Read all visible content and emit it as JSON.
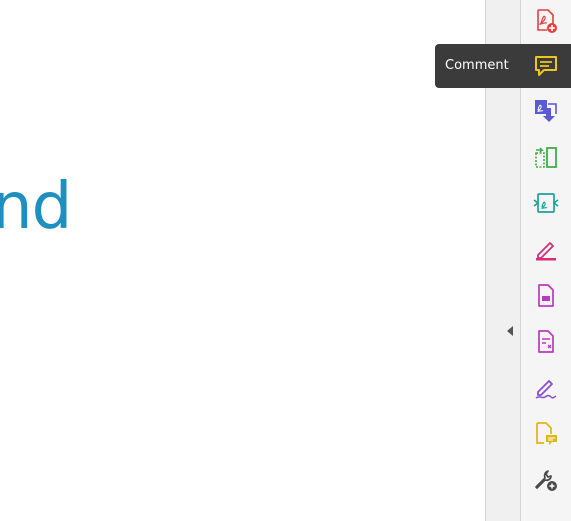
{
  "document": {
    "visible_text": "nd",
    "text_color": "#1f8fbf"
  },
  "tooltip": {
    "label": "Comment"
  },
  "toolbar": {
    "tools": [
      {
        "name": "create-pdf",
        "icon": "create-pdf-icon",
        "color": "#e0403f"
      },
      {
        "name": "comment",
        "icon": "comment-icon",
        "color": "#f0c419",
        "active": true
      },
      {
        "name": "export-pdf",
        "icon": "export-pdf-icon",
        "color": "#5a5ad6"
      },
      {
        "name": "organize-pages",
        "icon": "organize-pages-icon",
        "color": "#3fae49"
      },
      {
        "name": "compress-pdf",
        "icon": "compress-pdf-icon",
        "color": "#1aa39b"
      },
      {
        "name": "fill-sign",
        "icon": "fill-sign-icon",
        "color": "#d6307c"
      },
      {
        "name": "protect",
        "icon": "protect-icon",
        "color": "#b83bbf"
      },
      {
        "name": "prepare-form",
        "icon": "prepare-form-icon",
        "color": "#b83bbf"
      },
      {
        "name": "request-signatures",
        "icon": "request-signatures-icon",
        "color": "#8a4fd1"
      },
      {
        "name": "send-for-comments",
        "icon": "send-for-comments-icon",
        "color": "#e2b51a"
      },
      {
        "name": "more-tools",
        "icon": "more-tools-icon",
        "color": "#4a4a4a"
      }
    ]
  }
}
